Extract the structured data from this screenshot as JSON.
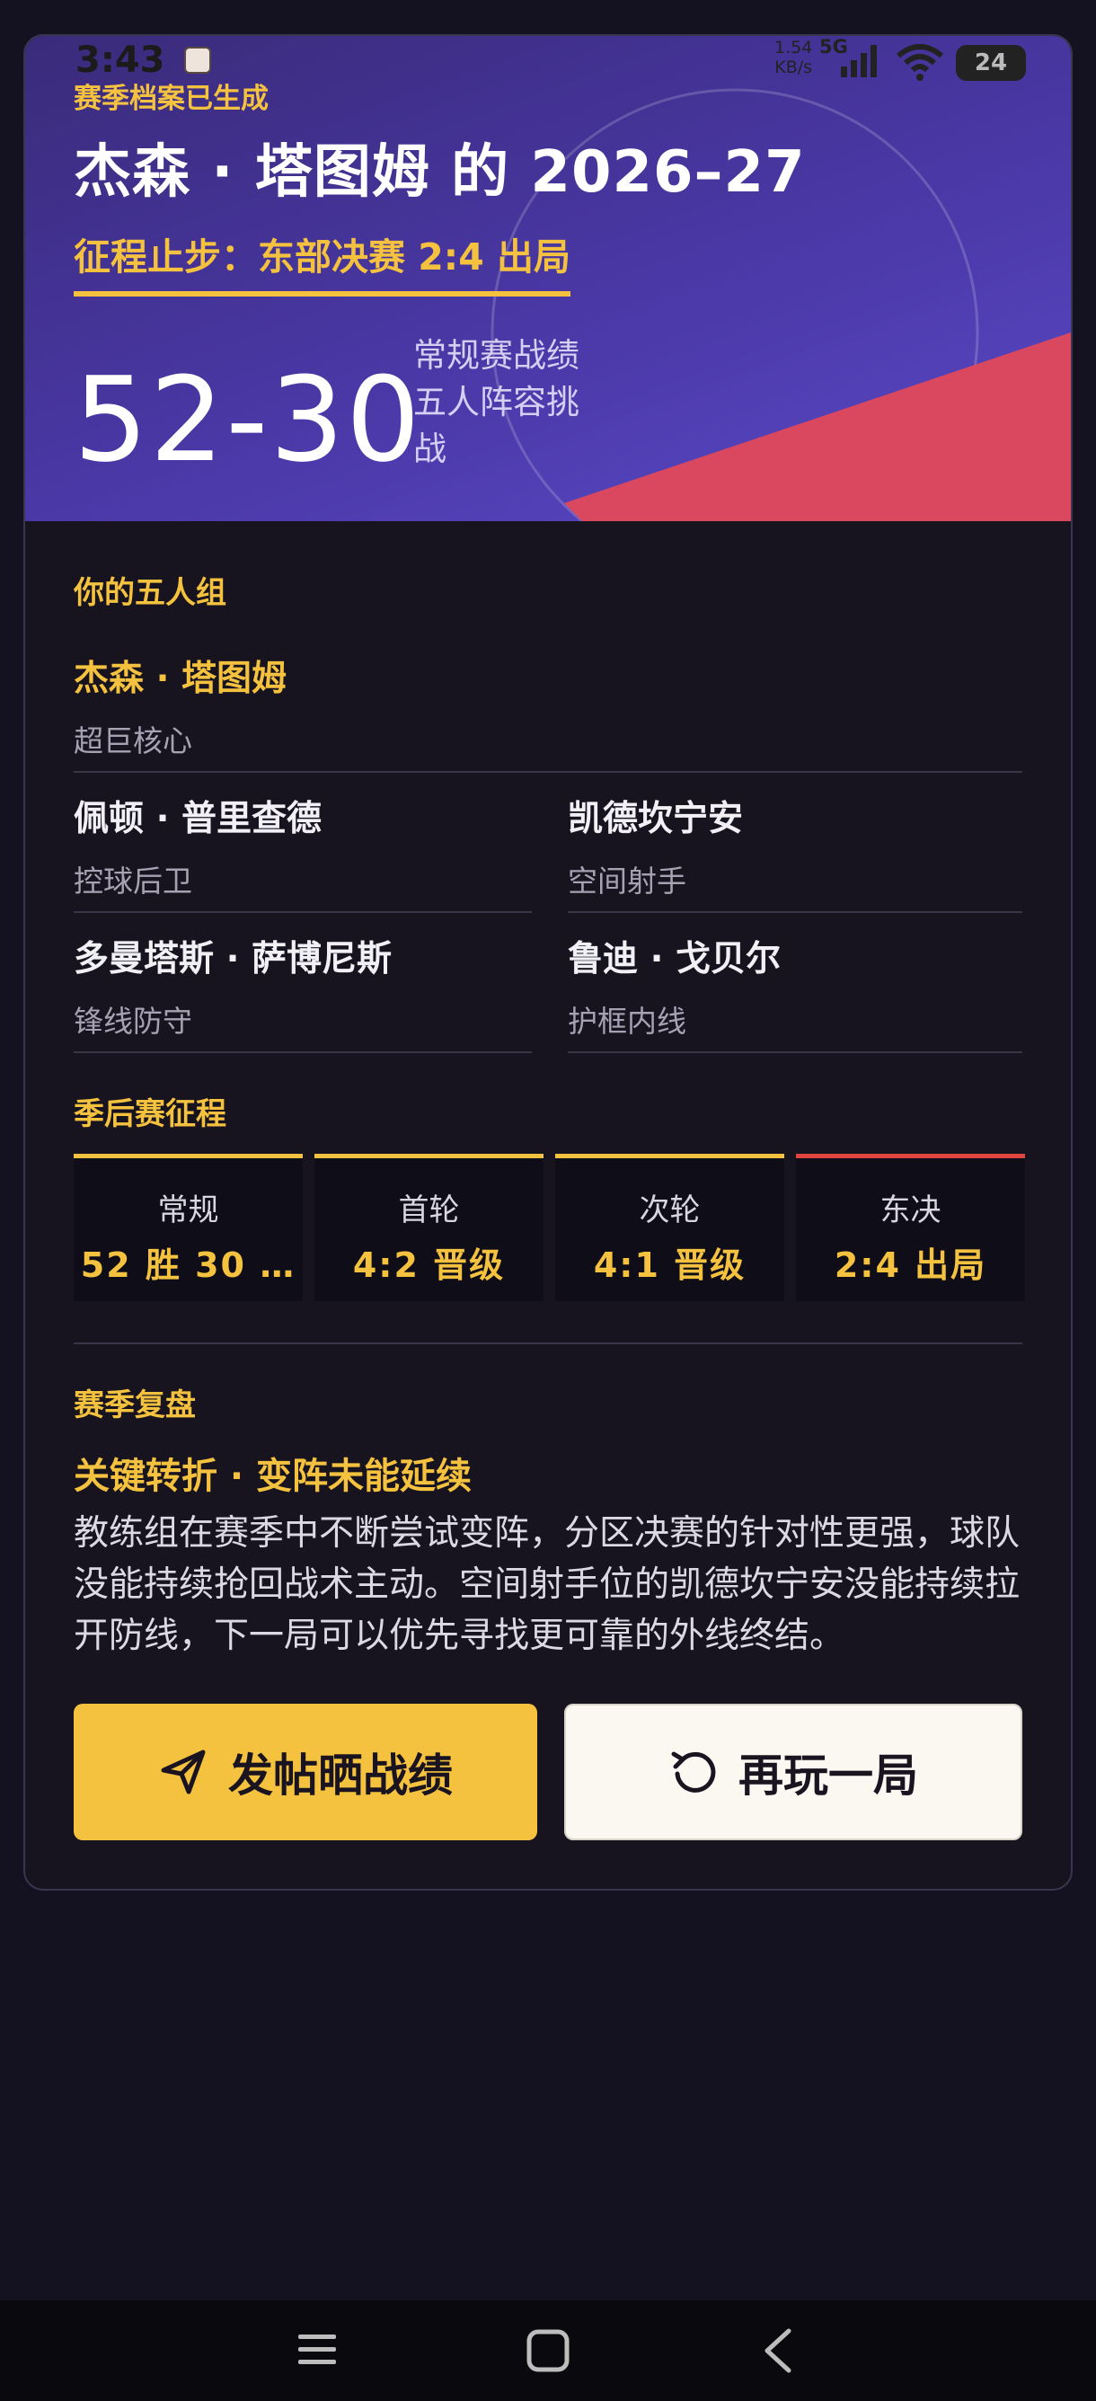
{
  "status_bar": {
    "time": "3:43",
    "net_speed": "1.54",
    "net_unit": "KB/s",
    "network": "5G",
    "battery": "24"
  },
  "hero": {
    "eyebrow": "赛季档案已生成",
    "title": "杰森 · 塔图姆 的 2026–27",
    "subtitle": "征程止步：东部决赛 2:4 出局",
    "record": "52-30",
    "record_label": "常规赛战绩 五人阵容挑战"
  },
  "lineup": {
    "heading": "你的五人组",
    "star": {
      "name": "杰森 · 塔图姆",
      "role": "超巨核心"
    },
    "players": [
      {
        "name": "佩顿 · 普里查德",
        "role": "控球后卫"
      },
      {
        "name": "凯德坎宁安",
        "role": "空间射手"
      },
      {
        "name": "多曼塔斯 · 萨博尼斯",
        "role": "锋线防守"
      },
      {
        "name": "鲁迪 · 戈贝尔",
        "role": "护框内线"
      }
    ]
  },
  "playoffs": {
    "heading": "季后赛征程",
    "stages": [
      {
        "name": "常规",
        "result": "52 胜 30 …",
        "status": "advanced"
      },
      {
        "name": "首轮",
        "result": "4:2 晋级",
        "status": "advanced"
      },
      {
        "name": "次轮",
        "result": "4:1 晋级",
        "status": "advanced"
      },
      {
        "name": "东决",
        "result": "2:4 出局",
        "status": "eliminated"
      }
    ],
    "colors": {
      "advanced": "#f4c23f",
      "eliminated": "#e0443e"
    }
  },
  "review": {
    "heading": "赛季复盘",
    "key_turn": "关键转折 · 变阵未能延续",
    "body": "教练组在赛季中不断尝试变阵，分区决赛的针对性更强，球队没能持续抢回战术主动。空间射手位的凯德坎宁安没能持续拉开防线，下一局可以优先寻找更可靠的外线终结。"
  },
  "actions": {
    "share_label": "发帖晒战绩",
    "share_icon": "send-icon",
    "replay_label": "再玩一局",
    "replay_icon": "replay-icon"
  },
  "theme": {
    "accent": "#f4c23f",
    "hero_bg": "#4a38a6",
    "danger": "#e0443e"
  }
}
